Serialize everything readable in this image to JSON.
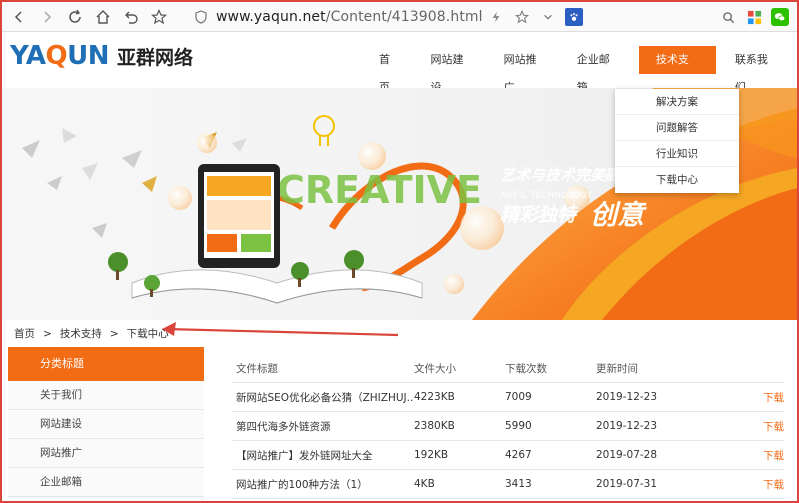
{
  "browser": {
    "url_host": "www.yaqun.net",
    "url_path": "/Content/413908.html"
  },
  "site": {
    "logo_en_pre": "YA",
    "logo_en_q": "Q",
    "logo_en_post": "UN",
    "logo_cn": "亚群网络",
    "nav": [
      "首页",
      "网站建设",
      "网站推广",
      "企业邮箱",
      "技术支持",
      "联系我们"
    ],
    "active_nav": "技术支持"
  },
  "banner": {
    "creative_text": "CREATIVE",
    "line1": "艺术与技术完美融合",
    "line2": "ART & TECHNOLOGY",
    "line3": "精彩独特",
    "line4": "创意"
  },
  "dropdown": {
    "items": [
      "解决方案",
      "问题解答",
      "行业知识",
      "下载中心"
    ]
  },
  "breadcrumb": {
    "items": [
      "首页",
      "技术支持",
      "下载中心"
    ],
    "separator": ">"
  },
  "sidebar": {
    "title": "分类标题",
    "items": [
      "关于我们",
      "网站建设",
      "网站推广",
      "企业邮箱"
    ]
  },
  "table": {
    "headers": [
      "文件标题",
      "文件大小",
      "下载次数",
      "更新时间",
      ""
    ],
    "rows": [
      {
        "title": "新网站SEO优化必备公猜（ZHIZHUJ...",
        "size": "4223KB",
        "count": "7009",
        "date": "2019-12-23",
        "action": "下载"
      },
      {
        "title": "第四代海多外链资源",
        "size": "2380KB",
        "count": "5990",
        "date": "2019-12-23",
        "action": "下载"
      },
      {
        "title": "【网站推广】发外链网址大全",
        "size": "192KB",
        "count": "4267",
        "date": "2019-07-28",
        "action": "下载"
      },
      {
        "title": "网站推广的100种方法（1）",
        "size": "4KB",
        "count": "3413",
        "date": "2019-07-31",
        "action": "下载"
      }
    ]
  },
  "colors": {
    "brand_orange": "#f26b15",
    "brand_blue": "#1e6fb5",
    "annotation_red": "#d9453a"
  }
}
